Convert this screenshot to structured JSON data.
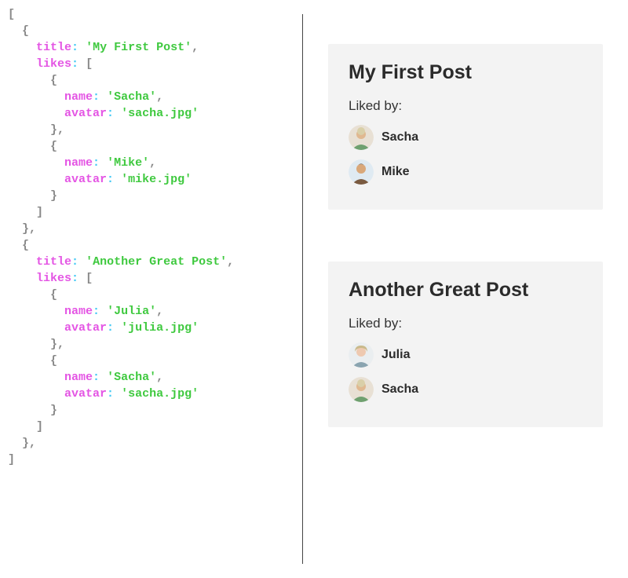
{
  "code": {
    "posts": [
      {
        "title_key": "title",
        "title_val": "'My First Post'",
        "likes_key": "likes",
        "likes": [
          {
            "name_key": "name",
            "name_val": "'Sacha'",
            "avatar_key": "avatar",
            "avatar_val": "'sacha.jpg'"
          },
          {
            "name_key": "name",
            "name_val": "'Mike'",
            "avatar_key": "avatar",
            "avatar_val": "'mike.jpg'"
          }
        ]
      },
      {
        "title_key": "title",
        "title_val": "'Another Great Post'",
        "likes_key": "likes",
        "likes": [
          {
            "name_key": "name",
            "name_val": "'Julia'",
            "avatar_key": "avatar",
            "avatar_val": "'julia.jpg'"
          },
          {
            "name_key": "name",
            "name_val": "'Sacha'",
            "avatar_key": "avatar",
            "avatar_val": "'sacha.jpg'"
          }
        ]
      }
    ]
  },
  "cards": [
    {
      "title": "My First Post",
      "liked_label": "Liked by:",
      "likers": [
        {
          "name": "Sacha",
          "avatar_id": "sacha"
        },
        {
          "name": "Mike",
          "avatar_id": "mike"
        }
      ]
    },
    {
      "title": "Another Great Post",
      "liked_label": "Liked by:",
      "likers": [
        {
          "name": "Julia",
          "avatar_id": "julia"
        },
        {
          "name": "Sacha",
          "avatar_id": "sacha"
        }
      ]
    }
  ]
}
